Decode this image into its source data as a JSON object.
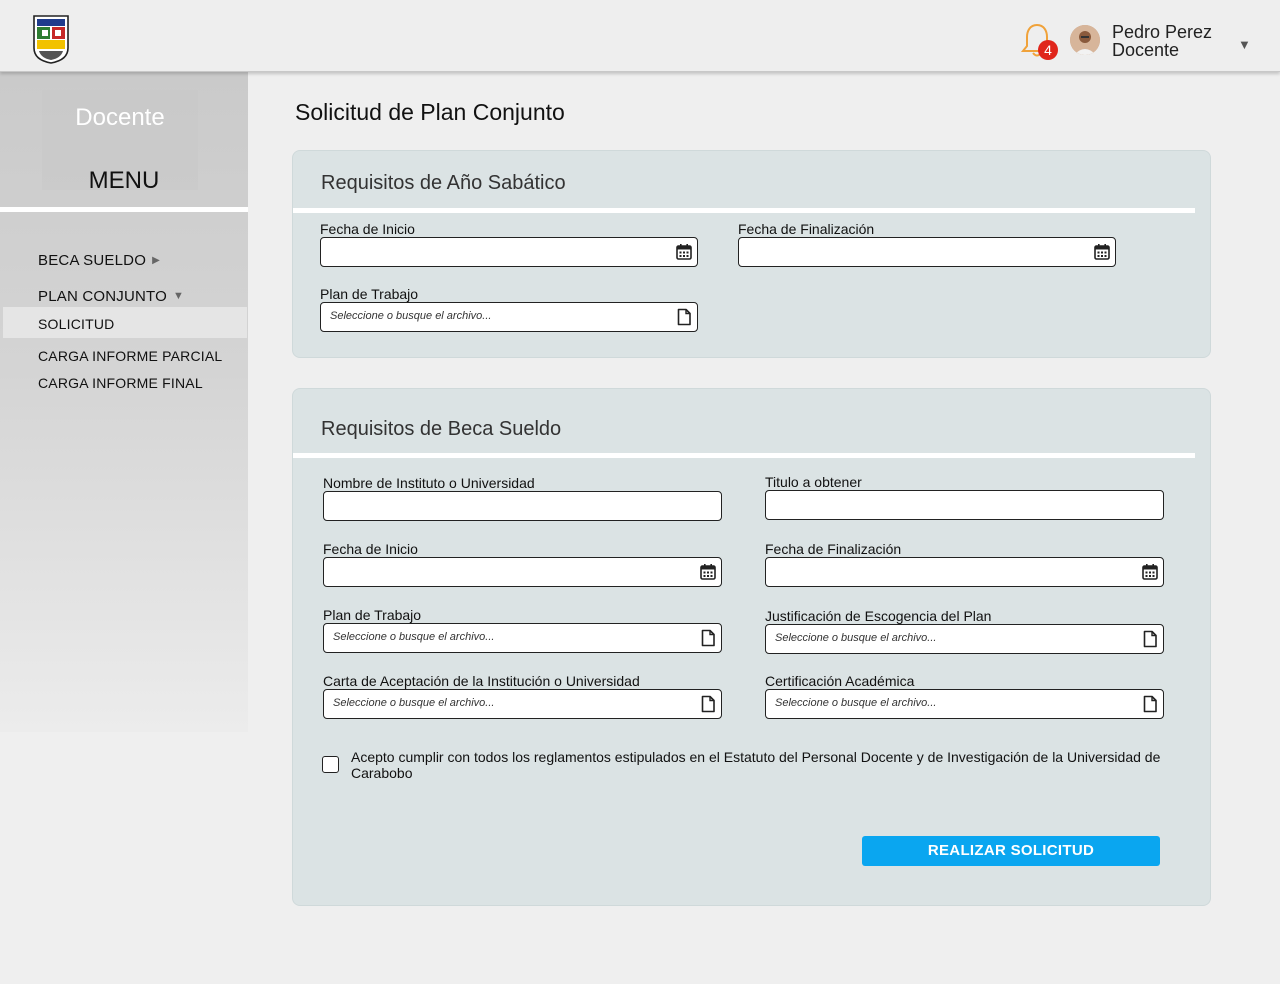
{
  "header": {
    "notification_count": "4",
    "user_name": "Pedro Perez",
    "user_role": "Docente",
    "colors": {
      "badge": "#e0251b",
      "bell": "#f0a23a"
    }
  },
  "sidebar": {
    "title": "Docente",
    "menu_label": "MENU",
    "items": [
      {
        "label": "BECA SUELDO",
        "arrow": "▶"
      },
      {
        "label": "PLAN CONJUNTO",
        "arrow": "▼"
      },
      {
        "label": "SOLICITUD"
      },
      {
        "label": "CARGA INFORME PARCIAL"
      },
      {
        "label": "CARGA INFORME FINAL"
      }
    ]
  },
  "main": {
    "page_title": "Solicitud de Plan Conjunto",
    "sabatico": {
      "title": "Requisitos de Año Sabático",
      "fecha_inicio_label": "Fecha de Inicio",
      "fecha_fin_label": "Fecha de Finalización",
      "plan_label": "Plan de Trabajo",
      "plan_placeholder": "Seleccione o busque el archivo..."
    },
    "beca": {
      "title": "Requisitos de Beca Sueldo",
      "instituto_label": "Nombre de Instituto o Universidad",
      "titulo_label": "Titulo a obtener",
      "fecha_inicio_label": "Fecha de Inicio",
      "fecha_fin_label": "Fecha de Finalización",
      "plan_label": "Plan de Trabajo",
      "plan_placeholder": "Seleccione o busque el archivo...",
      "justificacion_label": "Justificación de Escogencia del Plan",
      "justificacion_placeholder": "Seleccione o busque el archivo...",
      "carta_label": "Carta de Aceptación de la Institución o Universidad",
      "carta_placeholder": "Seleccione o busque el archivo...",
      "certificacion_label": "Certificación Académica",
      "certificacion_placeholder": "Seleccione o busque el archivo...",
      "accept_text": "Acepto cumplir con todos los reglamentos estipulados en el Estatuto del Personal Docente y de Investigación de la Universidad de Carabobo",
      "submit_label": "REALIZAR SOLICITUD",
      "accent_color": "#0aa6f0"
    }
  }
}
